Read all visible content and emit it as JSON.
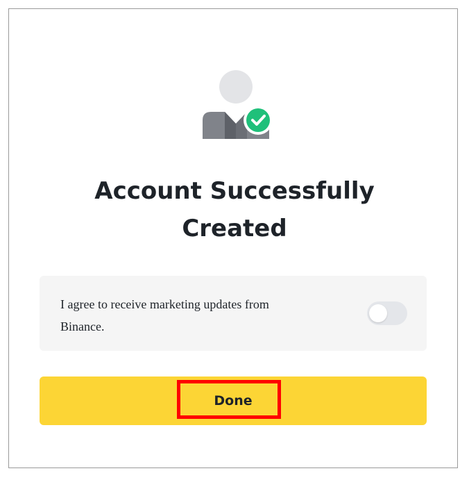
{
  "dialog": {
    "title_line1": "Account Successfully",
    "title_line2": "Created",
    "avatar_icon": "user-check-icon",
    "consent": {
      "text_line1": "I agree to receive marketing updates from",
      "text_line2": "Binance.",
      "toggle_on": false
    },
    "done_label": "Done"
  },
  "colors": {
    "accent_yellow": "#fcd535",
    "success_green": "#1fc07a",
    "text_primary": "#1e2329",
    "highlight_red": "#ff0000"
  }
}
